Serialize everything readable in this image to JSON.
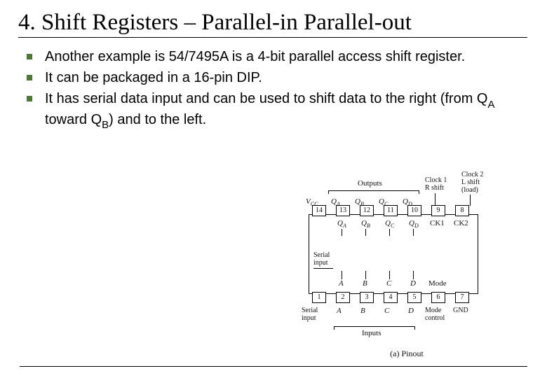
{
  "title": "4. Shift Registers – Parallel-in Parallel-out",
  "bullets": [
    "Another example is 54/7495A is a 4-bit parallel access shift register.",
    "It can be packaged in a 16-pin DIP.",
    "It has serial data input and can be used to shift data to the right (from QA toward QB) and to the left."
  ],
  "diagram": {
    "top_group": "Outputs",
    "top_right1": "Clock 1 R shift",
    "top_right2": "Clock 2 L shift (load)",
    "top_pins": [
      "14",
      "13",
      "12",
      "11",
      "10",
      "9",
      "8"
    ],
    "top_labels_outer": [
      "V_CC",
      "Q_A",
      "Q_B",
      "Q_C",
      "Q_D",
      "",
      ""
    ],
    "top_labels_inner": [
      "",
      "Q_A",
      "Q_B",
      "Q_C",
      "Q_D",
      "CK1",
      "CK2"
    ],
    "bot_pins": [
      "1",
      "2",
      "3",
      "4",
      "5",
      "6",
      "7"
    ],
    "bot_labels_inner": [
      "",
      "A",
      "B",
      "C",
      "D",
      "Mode",
      ""
    ],
    "bot_labels_outer": [
      "Serial input",
      "A",
      "B",
      "C",
      "D",
      "Mode control",
      "GND"
    ],
    "bot_group": "Inputs",
    "serial_input": "Serial input",
    "caption": "(a) Pinout"
  }
}
